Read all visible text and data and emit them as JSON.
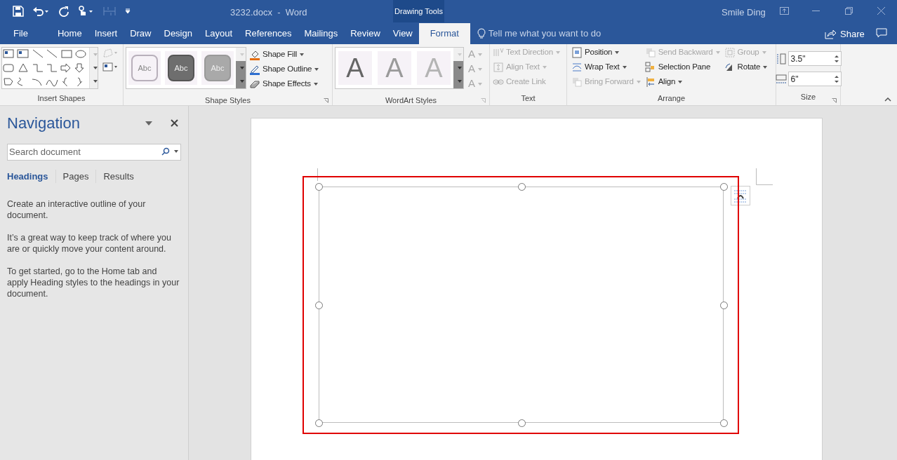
{
  "title_bar": {
    "document_title": "3232.docx  -  Word",
    "context_label": "Drawing Tools",
    "user": "Smile Ding"
  },
  "menu_tabs": [
    {
      "label": "File",
      "selected": false
    },
    {
      "label": "Home",
      "selected": false
    },
    {
      "label": "Insert",
      "selected": false
    },
    {
      "label": "Draw",
      "selected": false
    },
    {
      "label": "Design",
      "selected": false
    },
    {
      "label": "Layout",
      "selected": false
    },
    {
      "label": "References",
      "selected": false
    },
    {
      "label": "Mailings",
      "selected": false
    },
    {
      "label": "Review",
      "selected": false
    },
    {
      "label": "View",
      "selected": false
    },
    {
      "label": "Format",
      "selected": true
    }
  ],
  "tell_me": {
    "placeholder": "Tell me what you want to do"
  },
  "share": "Share",
  "ribbon": {
    "insert_shapes": {
      "label": "Insert Shapes"
    },
    "shape_styles": {
      "samples": [
        {
          "text": "Abc",
          "kind": "light"
        },
        {
          "text": "Abc",
          "kind": "dark"
        },
        {
          "text": "Abc",
          "kind": "medium"
        }
      ],
      "commands": [
        {
          "label": "Shape Fill",
          "kind": "fill"
        },
        {
          "label": "Shape Outline",
          "kind": "outline"
        },
        {
          "label": "Shape Effects",
          "kind": "effects"
        }
      ],
      "label": "Shape Styles"
    },
    "wordart_styles": {
      "samples": [
        {
          "text": "A",
          "kind": "dark"
        },
        {
          "text": "A",
          "kind": "medium"
        },
        {
          "text": "A",
          "kind": "light"
        }
      ],
      "effects": [
        "A",
        "A",
        "A"
      ],
      "label": "WordArt Styles"
    },
    "text": {
      "commands": [
        {
          "label": "Text Direction",
          "disabled": true
        },
        {
          "label": "Align Text",
          "disabled": true
        },
        {
          "label": "Create Link",
          "disabled": true
        }
      ],
      "label": "Text"
    },
    "arrange": {
      "commands": [
        {
          "label": "Position",
          "disabled": false
        },
        {
          "label": "Wrap Text",
          "disabled": false
        },
        {
          "label": "Bring Forward",
          "disabled": true
        },
        {
          "label": "Send Backward",
          "disabled": true
        },
        {
          "label": "Selection Pane",
          "disabled": false
        },
        {
          "label": "Align",
          "disabled": false
        },
        {
          "label": "Group",
          "disabled": true
        },
        {
          "label": "Rotate",
          "disabled": false
        }
      ],
      "label": "Arrange"
    },
    "size": {
      "height": "3.5\"",
      "width": "6\"",
      "label": "Size"
    }
  },
  "navigation": {
    "title": "Navigation",
    "search": {
      "placeholder": "Search document"
    },
    "tabs": [
      {
        "label": "Headings",
        "selected": true
      },
      {
        "label": "Pages",
        "selected": false
      },
      {
        "label": "Results",
        "selected": false
      }
    ],
    "paragraphs": [
      "Create an interactive outline of your document.",
      "It’s a great way to keep track of where you are or quickly move your content around.",
      "To get started, go to the Home tab and apply Heading styles to the headings in your document."
    ]
  },
  "document": {
    "shape_selected": true
  }
}
